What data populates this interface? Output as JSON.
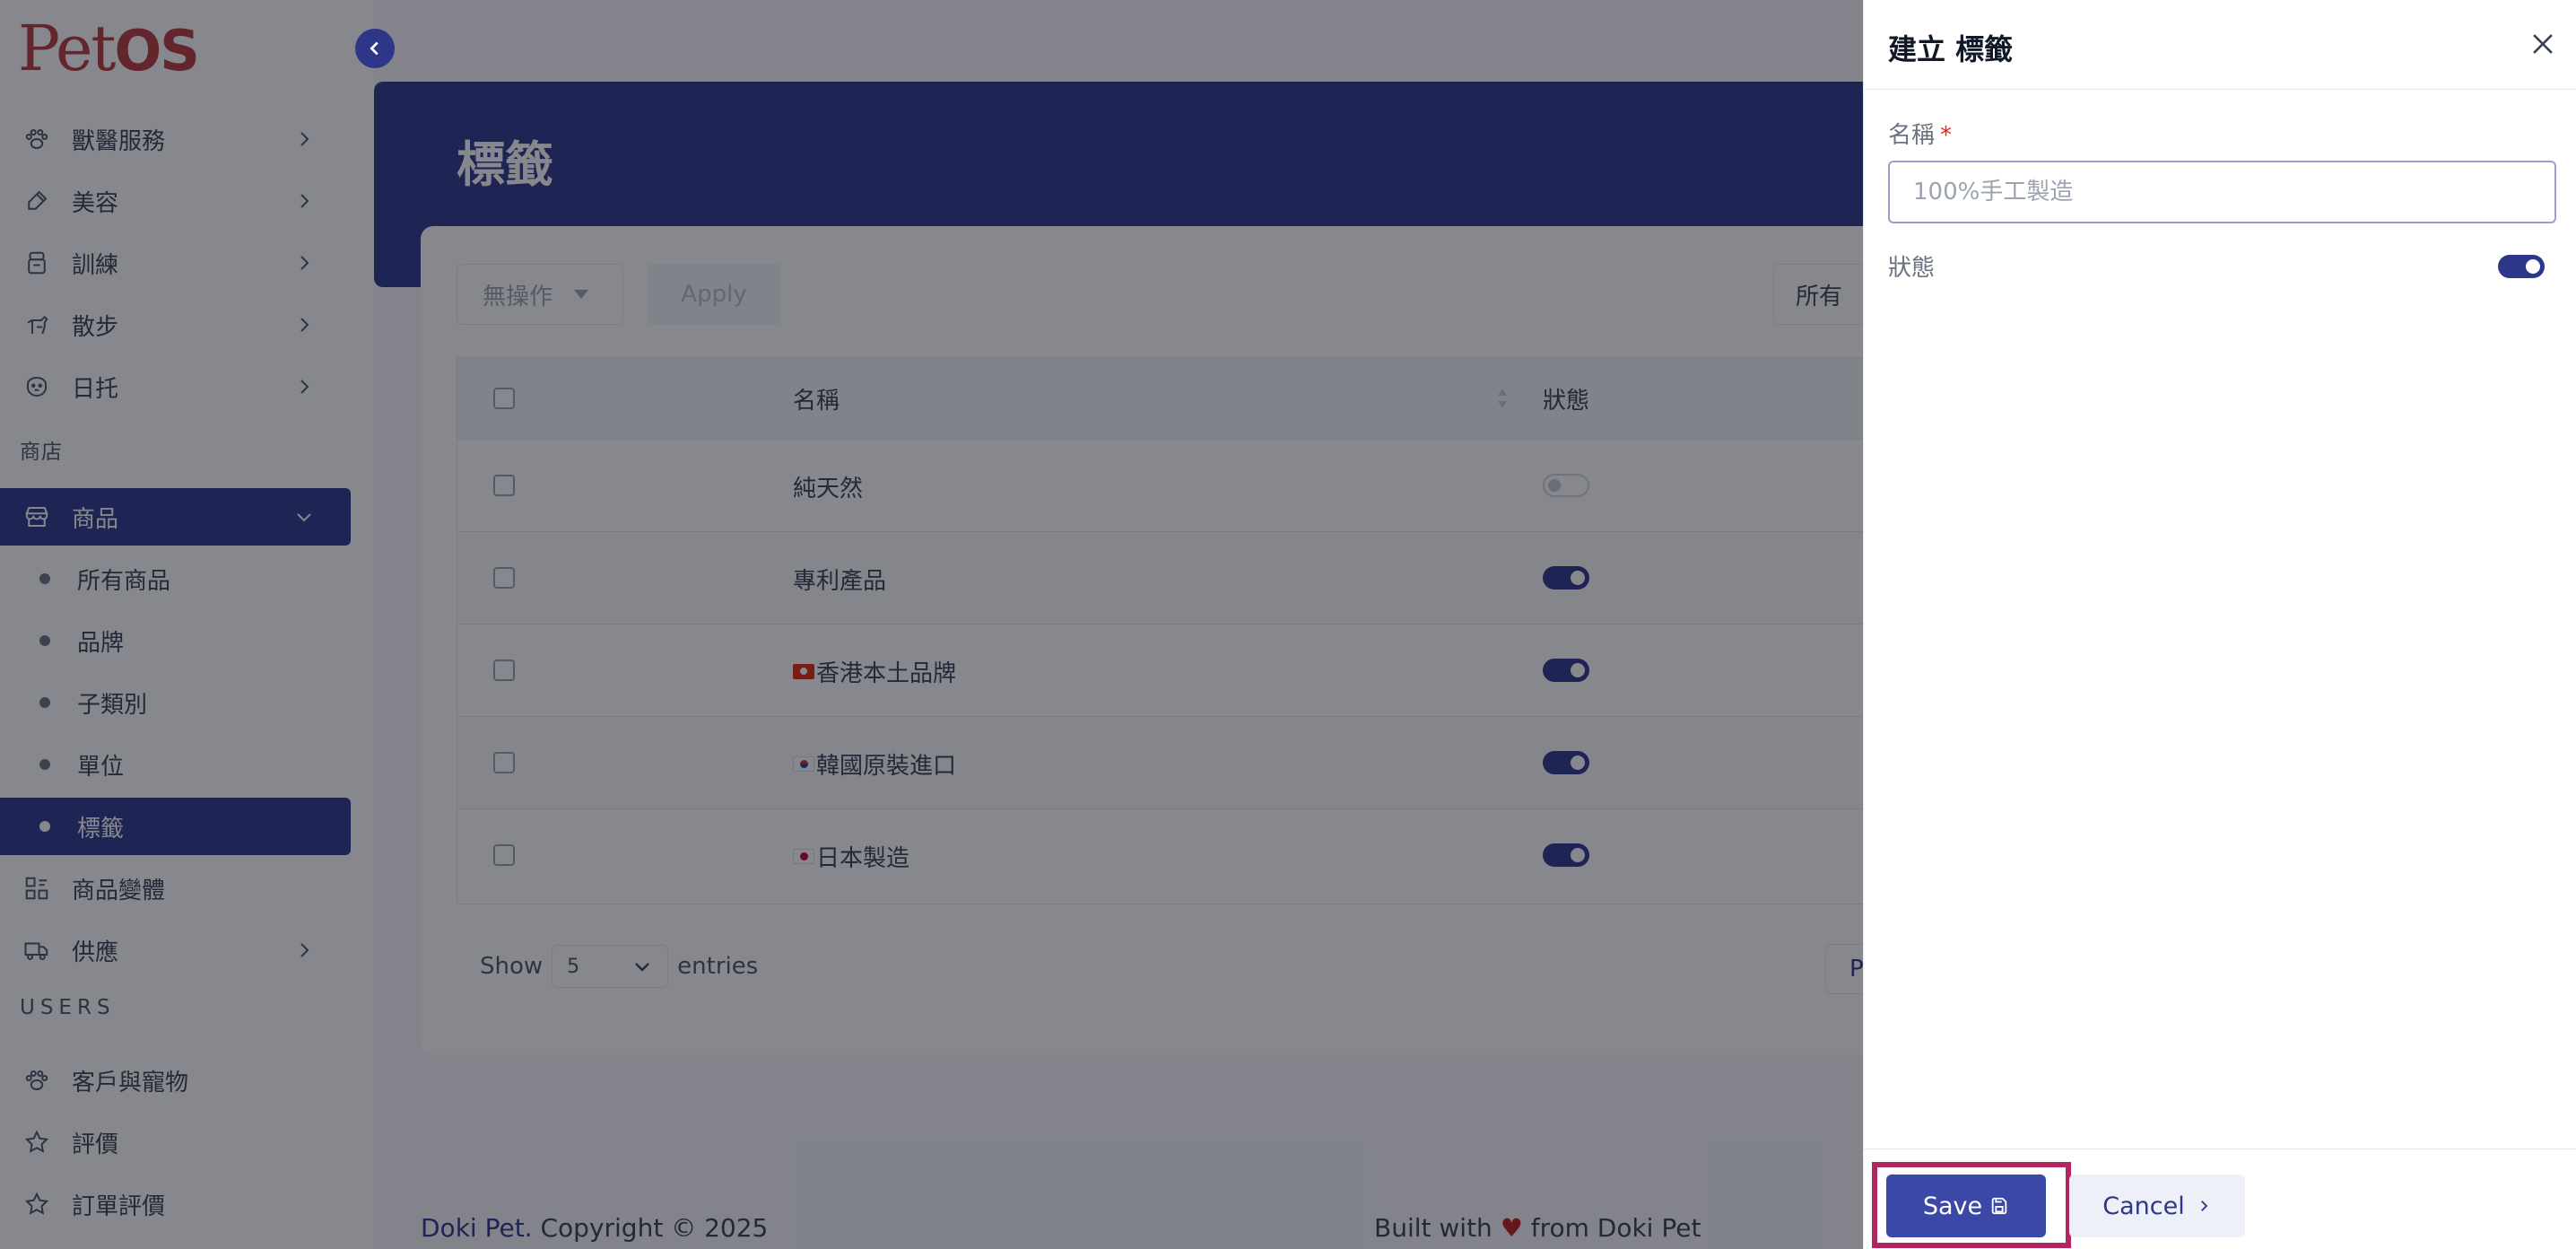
{
  "app": {
    "logo": "PetOS"
  },
  "sidebar": {
    "items": [
      {
        "label": "獸醫服務",
        "icon": "paw-icon"
      },
      {
        "label": "美容",
        "icon": "brush-icon"
      },
      {
        "label": "訓練",
        "icon": "training-icon"
      },
      {
        "label": "散步",
        "icon": "dog-walk-icon"
      },
      {
        "label": "日托",
        "icon": "daycare-icon"
      }
    ],
    "section_shop": "商店",
    "products": {
      "label": "商品",
      "icon": "store-icon"
    },
    "sub_items": [
      {
        "label": "所有商品"
      },
      {
        "label": "品牌"
      },
      {
        "label": "子類別"
      },
      {
        "label": "單位"
      },
      {
        "label": "標籤"
      }
    ],
    "variants": {
      "label": "商品變體",
      "icon": "variant-icon"
    },
    "supply": {
      "label": "供應",
      "icon": "truck-icon"
    },
    "section_users": "USERS",
    "users": [
      {
        "label": "客戶與寵物",
        "icon": "customer-paw-icon"
      },
      {
        "label": "評價",
        "icon": "star-icon"
      },
      {
        "label": "訂單評價",
        "icon": "star-icon"
      }
    ]
  },
  "page": {
    "title": "標籤",
    "bulk_action": "無操作",
    "apply_label": "Apply",
    "filter_label": "所有"
  },
  "table": {
    "headers": {
      "name": "名稱",
      "status": "狀態"
    },
    "rows": [
      {
        "name": "純天然",
        "flag": "",
        "status": false
      },
      {
        "name": "專利產品",
        "flag": "",
        "status": true
      },
      {
        "name": "香港本土品牌",
        "flag": "hk",
        "status": true
      },
      {
        "name": "韓國原裝進口",
        "flag": "kr",
        "status": true
      },
      {
        "name": "日本製造",
        "flag": "jp",
        "status": true
      }
    ]
  },
  "pagination": {
    "show_label": "Show",
    "page_size": "5",
    "entries_label": "entries",
    "previous_label": "Previ"
  },
  "footer": {
    "brand": "Doki Pet.",
    "copyright": "Copyright © 2025",
    "built_prefix": "Built with",
    "heart": "♥",
    "built_suffix": "from Doki Pet"
  },
  "drawer": {
    "title": "建立 標籤",
    "name_label": "名稱",
    "required_mark": "*",
    "name_placeholder": "100%手工製造",
    "status_label": "狀態",
    "status_on": true,
    "save_label": "Save",
    "cancel_label": "Cancel"
  },
  "colors": {
    "primary": "#2d3688",
    "logo": "#b73a3a",
    "highlight": "#b0275f"
  }
}
